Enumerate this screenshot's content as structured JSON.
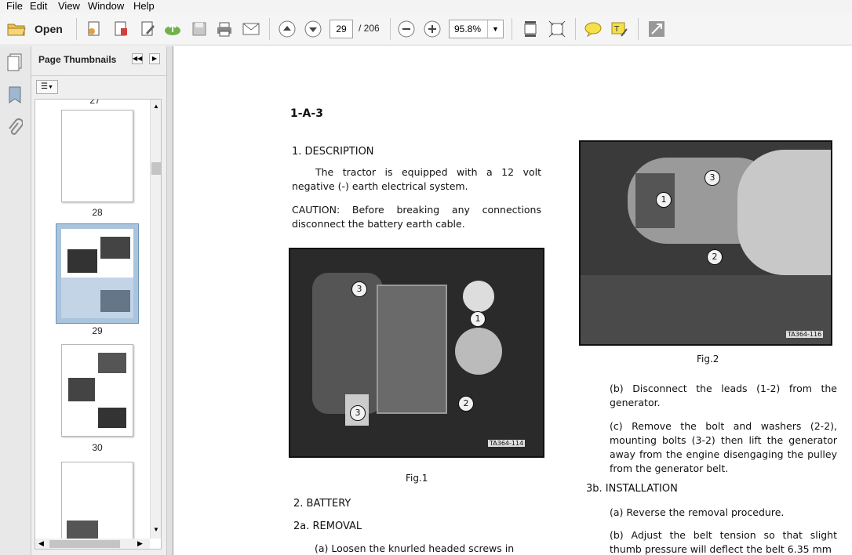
{
  "menu": {
    "file": "File",
    "edit": "Edit",
    "view": "View",
    "window": "Window",
    "help": "Help"
  },
  "toolbar": {
    "open_label": "Open",
    "current_page": "29",
    "page_total": "/ 206",
    "zoom": "95.8%"
  },
  "nav": {
    "title": "Page Thumbnails",
    "thumbnails": [
      {
        "label": "27"
      },
      {
        "label": "28"
      },
      {
        "label": "29"
      },
      {
        "label": "30"
      }
    ]
  },
  "document": {
    "section_id": "1-A-3",
    "h1": "1. DESCRIPTION",
    "p1": "The tractor is equipped with a 12 volt negative (-) earth electrical system.",
    "caution": "CAUTION: Before breaking any connections disconnect the battery earth cable.",
    "fig1_caption": "Fig.1",
    "fig1_tag": "TA364-114",
    "h2": "2. BATTERY",
    "h2a": "2a. REMOVAL",
    "p_remove": "(a) Loosen the knurled headed screws in",
    "fig2_tag": "TA364-116",
    "fig2_caption": "Fig.2",
    "step_b": "(b) Disconnect the leads (1-2) from the generator.",
    "step_c": "(c) Remove the bolt and washers (2-2), mounting bolts (3-2) then lift the generator away from the engine disengaging the pulley from the generator belt.",
    "h3b": "3b. INSTALLATION",
    "inst_a": "(a) Reverse the removal procedure.",
    "inst_b": "(b) Adjust the belt tension so that slight thumb pressure will deflect the belt 6.35 mm",
    "callouts_fig1": [
      "3",
      "1",
      "3",
      "2"
    ],
    "callouts_fig2": [
      "3",
      "1",
      "2"
    ]
  }
}
